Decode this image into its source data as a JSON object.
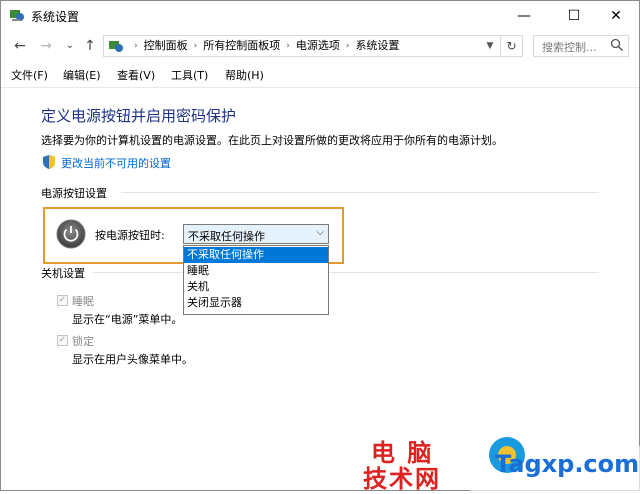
{
  "window": {
    "title": "系统设置"
  },
  "controls": {
    "minimize": "—",
    "maximize": "☐",
    "close": "✕"
  },
  "nav": {
    "back": "←",
    "forward": "→",
    "history": "⌄",
    "up": "↑",
    "breadcrumbs": [
      "控制面板",
      "所有控制面板项",
      "电源选项",
      "系统设置"
    ],
    "refresh": "↻"
  },
  "search": {
    "placeholder": "搜索控制..."
  },
  "menu": [
    "文件(F)",
    "编辑(E)",
    "查看(V)",
    "工具(T)",
    "帮助(H)"
  ],
  "page": {
    "title": "定义电源按钮并启用密码保护",
    "description": "选择要为你的计算机设置的电源设置。在此页上对设置所做的更改将应用于你所有的电源计划。",
    "admin_link": "更改当前不可用的设置",
    "power_section": "电源按钮设置",
    "power_label": "按电源按钮时:",
    "select_value": "不采取任何操作",
    "options": [
      "不采取任何操作",
      "睡眠",
      "关机",
      "关闭显示器"
    ],
    "selected_option_index": 0,
    "shutdown_section": "关机设置",
    "sleep_label": "睡眠",
    "sleep_desc": "显示在“电源”菜单中。",
    "lock_label": "锁定",
    "lock_desc": "显示在用户头像菜单中。"
  },
  "watermark": {
    "line1": "电 脑",
    "line2": "技术网",
    "url": "Tagxp.com"
  },
  "colors": {
    "title_blue": "#1e3287",
    "link_blue": "#0066cc",
    "highlight_orange": "#e39b2f",
    "selection_blue": "#0078d7"
  }
}
